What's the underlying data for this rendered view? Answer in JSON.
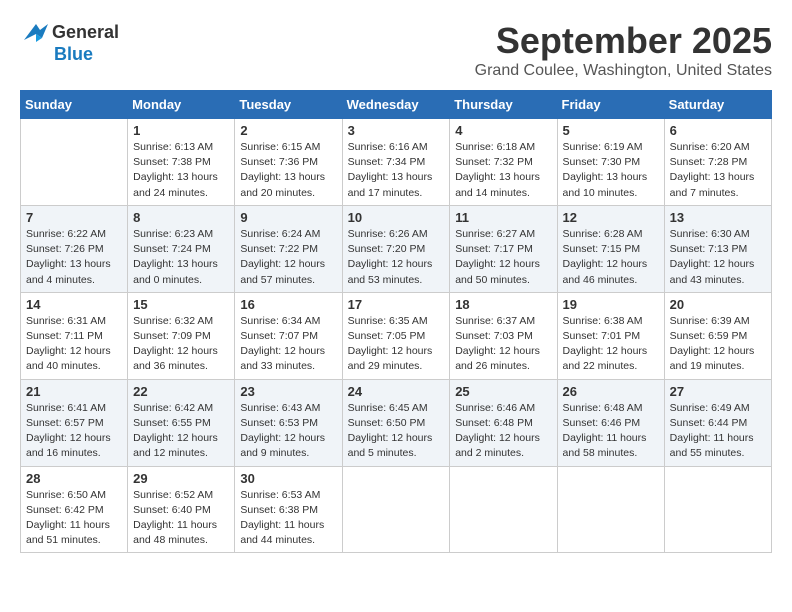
{
  "header": {
    "logo_general": "General",
    "logo_blue": "Blue",
    "month": "September 2025",
    "location": "Grand Coulee, Washington, United States"
  },
  "weekdays": [
    "Sunday",
    "Monday",
    "Tuesday",
    "Wednesday",
    "Thursday",
    "Friday",
    "Saturday"
  ],
  "weeks": [
    [
      {
        "day": "",
        "info": ""
      },
      {
        "day": "1",
        "info": "Sunrise: 6:13 AM\nSunset: 7:38 PM\nDaylight: 13 hours\nand 24 minutes."
      },
      {
        "day": "2",
        "info": "Sunrise: 6:15 AM\nSunset: 7:36 PM\nDaylight: 13 hours\nand 20 minutes."
      },
      {
        "day": "3",
        "info": "Sunrise: 6:16 AM\nSunset: 7:34 PM\nDaylight: 13 hours\nand 17 minutes."
      },
      {
        "day": "4",
        "info": "Sunrise: 6:18 AM\nSunset: 7:32 PM\nDaylight: 13 hours\nand 14 minutes."
      },
      {
        "day": "5",
        "info": "Sunrise: 6:19 AM\nSunset: 7:30 PM\nDaylight: 13 hours\nand 10 minutes."
      },
      {
        "day": "6",
        "info": "Sunrise: 6:20 AM\nSunset: 7:28 PM\nDaylight: 13 hours\nand 7 minutes."
      }
    ],
    [
      {
        "day": "7",
        "info": "Sunrise: 6:22 AM\nSunset: 7:26 PM\nDaylight: 13 hours\nand 4 minutes."
      },
      {
        "day": "8",
        "info": "Sunrise: 6:23 AM\nSunset: 7:24 PM\nDaylight: 13 hours\nand 0 minutes."
      },
      {
        "day": "9",
        "info": "Sunrise: 6:24 AM\nSunset: 7:22 PM\nDaylight: 12 hours\nand 57 minutes."
      },
      {
        "day": "10",
        "info": "Sunrise: 6:26 AM\nSunset: 7:20 PM\nDaylight: 12 hours\nand 53 minutes."
      },
      {
        "day": "11",
        "info": "Sunrise: 6:27 AM\nSunset: 7:17 PM\nDaylight: 12 hours\nand 50 minutes."
      },
      {
        "day": "12",
        "info": "Sunrise: 6:28 AM\nSunset: 7:15 PM\nDaylight: 12 hours\nand 46 minutes."
      },
      {
        "day": "13",
        "info": "Sunrise: 6:30 AM\nSunset: 7:13 PM\nDaylight: 12 hours\nand 43 minutes."
      }
    ],
    [
      {
        "day": "14",
        "info": "Sunrise: 6:31 AM\nSunset: 7:11 PM\nDaylight: 12 hours\nand 40 minutes."
      },
      {
        "day": "15",
        "info": "Sunrise: 6:32 AM\nSunset: 7:09 PM\nDaylight: 12 hours\nand 36 minutes."
      },
      {
        "day": "16",
        "info": "Sunrise: 6:34 AM\nSunset: 7:07 PM\nDaylight: 12 hours\nand 33 minutes."
      },
      {
        "day": "17",
        "info": "Sunrise: 6:35 AM\nSunset: 7:05 PM\nDaylight: 12 hours\nand 29 minutes."
      },
      {
        "day": "18",
        "info": "Sunrise: 6:37 AM\nSunset: 7:03 PM\nDaylight: 12 hours\nand 26 minutes."
      },
      {
        "day": "19",
        "info": "Sunrise: 6:38 AM\nSunset: 7:01 PM\nDaylight: 12 hours\nand 22 minutes."
      },
      {
        "day": "20",
        "info": "Sunrise: 6:39 AM\nSunset: 6:59 PM\nDaylight: 12 hours\nand 19 minutes."
      }
    ],
    [
      {
        "day": "21",
        "info": "Sunrise: 6:41 AM\nSunset: 6:57 PM\nDaylight: 12 hours\nand 16 minutes."
      },
      {
        "day": "22",
        "info": "Sunrise: 6:42 AM\nSunset: 6:55 PM\nDaylight: 12 hours\nand 12 minutes."
      },
      {
        "day": "23",
        "info": "Sunrise: 6:43 AM\nSunset: 6:53 PM\nDaylight: 12 hours\nand 9 minutes."
      },
      {
        "day": "24",
        "info": "Sunrise: 6:45 AM\nSunset: 6:50 PM\nDaylight: 12 hours\nand 5 minutes."
      },
      {
        "day": "25",
        "info": "Sunrise: 6:46 AM\nSunset: 6:48 PM\nDaylight: 12 hours\nand 2 minutes."
      },
      {
        "day": "26",
        "info": "Sunrise: 6:48 AM\nSunset: 6:46 PM\nDaylight: 11 hours\nand 58 minutes."
      },
      {
        "day": "27",
        "info": "Sunrise: 6:49 AM\nSunset: 6:44 PM\nDaylight: 11 hours\nand 55 minutes."
      }
    ],
    [
      {
        "day": "28",
        "info": "Sunrise: 6:50 AM\nSunset: 6:42 PM\nDaylight: 11 hours\nand 51 minutes."
      },
      {
        "day": "29",
        "info": "Sunrise: 6:52 AM\nSunset: 6:40 PM\nDaylight: 11 hours\nand 48 minutes."
      },
      {
        "day": "30",
        "info": "Sunrise: 6:53 AM\nSunset: 6:38 PM\nDaylight: 11 hours\nand 44 minutes."
      },
      {
        "day": "",
        "info": ""
      },
      {
        "day": "",
        "info": ""
      },
      {
        "day": "",
        "info": ""
      },
      {
        "day": "",
        "info": ""
      }
    ]
  ]
}
